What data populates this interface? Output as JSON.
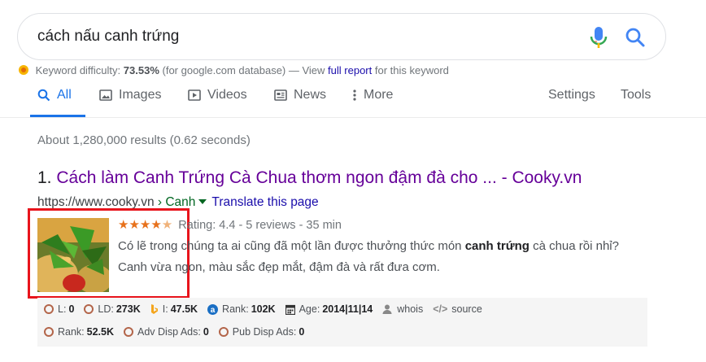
{
  "search": {
    "query": "cách nấu canh trứng"
  },
  "seo_bar": {
    "label": "Keyword difficulty:",
    "value": "73.53%",
    "db_text": "(for google.com database) — View",
    "link": "full report",
    "suffix": "for this keyword"
  },
  "tabs": [
    {
      "label": "All",
      "icon": "search-icon",
      "active": true
    },
    {
      "label": "Images",
      "icon": "image-icon"
    },
    {
      "label": "Videos",
      "icon": "play-icon"
    },
    {
      "label": "News",
      "icon": "news-icon"
    },
    {
      "label": "More",
      "icon": "more-icon"
    },
    {
      "label": "Settings"
    },
    {
      "label": "Tools"
    }
  ],
  "stats": "About 1,280,000 results (0.62 seconds)",
  "result": {
    "number": "1.",
    "title": "Cách làm Canh Trứng Cà Chua thơm ngon đậm đà cho ... - Cooky.vn",
    "url": "https://www.cooky.vn",
    "breadcrumb": "› Canh",
    "translate": "Translate this page",
    "rating": "Rating: 4.4 - 5 reviews - 35 min",
    "snippet_1": "Có lẽ trong chúng ta ai cũng đã một lần được thưởng thức món",
    "snippet_bold": "canh trứng",
    "snippet_2": "cà chua rồi nhỉ? Canh vừa ngon, màu sắc đẹp mắt, đậm đà và rất đưa cơm."
  },
  "metrics": {
    "row1": [
      {
        "label": "L:",
        "value": "0"
      },
      {
        "label": "LD:",
        "value": "273K"
      },
      {
        "label": "I:",
        "value": "47.5K"
      },
      {
        "label": "Rank:",
        "value": "102K"
      },
      {
        "label": "Age:",
        "value": "2014|11|14"
      },
      {
        "label": "whois",
        "value": ""
      },
      {
        "label": "source",
        "value": ""
      }
    ],
    "row2": [
      {
        "label": "Rank:",
        "value": "52.5K"
      },
      {
        "label": "Adv Disp Ads:",
        "value": "0"
      },
      {
        "label": "Pub Disp Ads:",
        "value": "0"
      }
    ]
  },
  "colors": {
    "accent": "#1a73e8",
    "visited_title": "#660099",
    "highlight_box": "#e8141c",
    "stars": "#e7711b"
  }
}
